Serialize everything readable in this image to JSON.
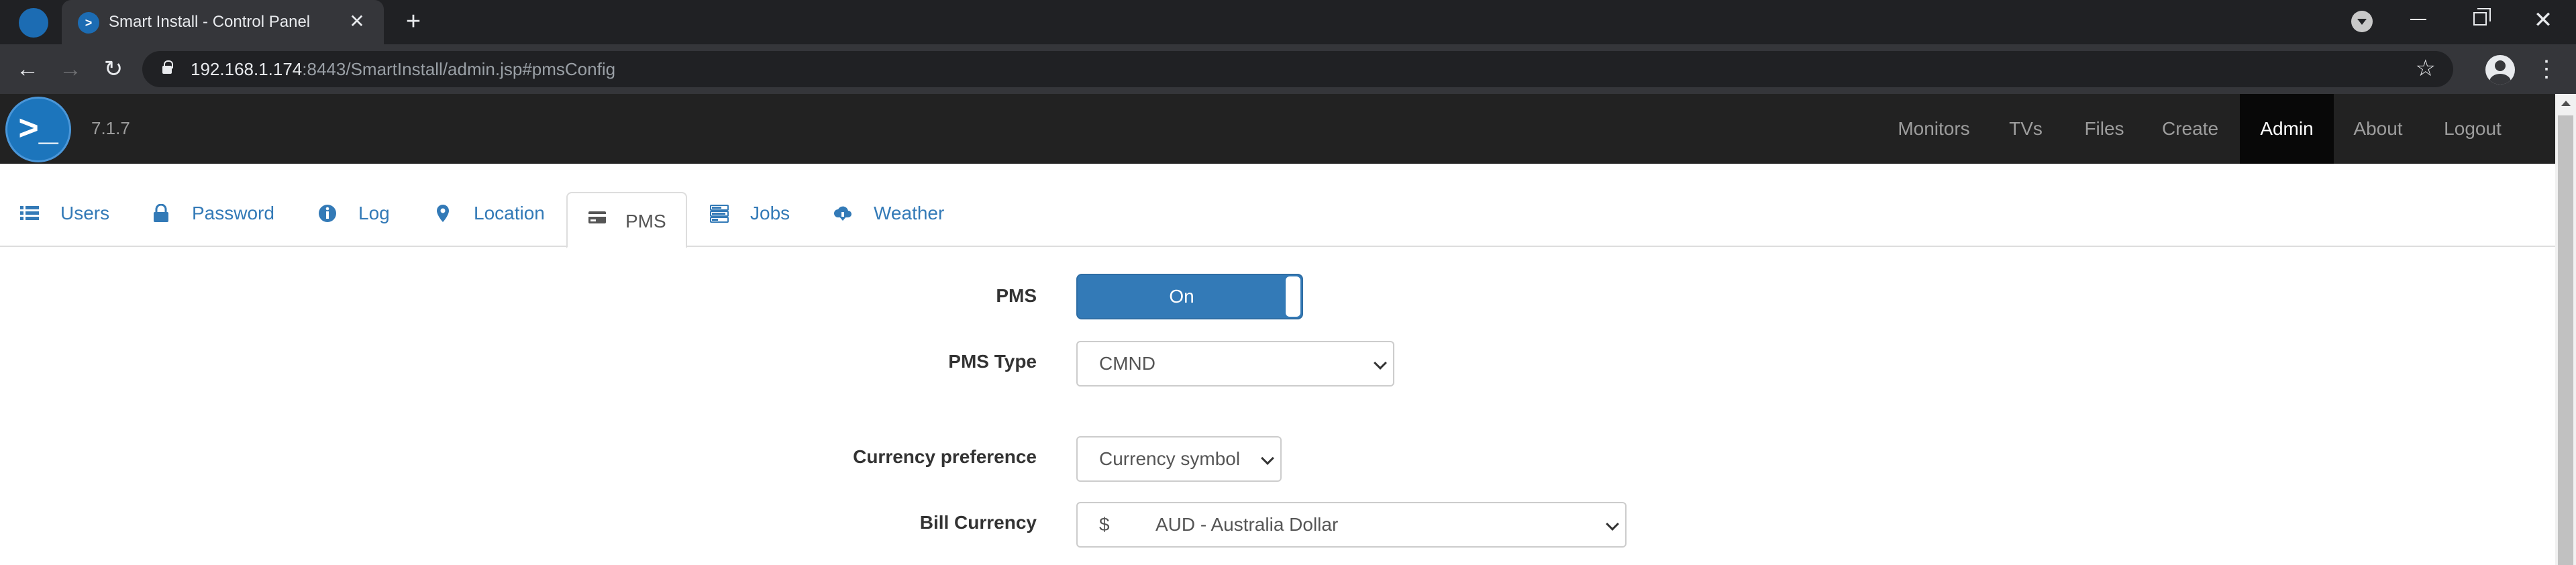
{
  "browser": {
    "tab_title": "Smart Install - Control Panel",
    "tab_close": "✕",
    "new_tab": "+",
    "url_host": "192.168.1.174",
    "url_rest": ":8443/SmartInstall/admin.jsp#pmsConfig",
    "back": "←",
    "forward": "→",
    "reload": "↻",
    "star": "☆",
    "menu": "⋮",
    "close_window": "✕",
    "favicon_glyph": ">"
  },
  "app": {
    "logo_glyph": ">_",
    "version": "7.1.7",
    "brand_color": "#1c75bc",
    "nav": [
      {
        "label": "Monitors",
        "active": false
      },
      {
        "label": "TVs",
        "active": false
      },
      {
        "label": "Files",
        "active": false
      },
      {
        "label": "Create",
        "active": false
      },
      {
        "label": "Admin",
        "active": true
      },
      {
        "label": "About",
        "active": false
      },
      {
        "label": "Logout",
        "active": false
      }
    ]
  },
  "tabs": [
    {
      "label": "Users",
      "icon": "list-icon",
      "active": false
    },
    {
      "label": "Password",
      "icon": "lock-icon",
      "active": false
    },
    {
      "label": "Log",
      "icon": "info-icon",
      "active": false
    },
    {
      "label": "Location",
      "icon": "map-marker-icon",
      "active": false
    },
    {
      "label": "PMS",
      "icon": "credit-card-icon",
      "active": true
    },
    {
      "label": "Jobs",
      "icon": "tasks-icon",
      "active": false
    },
    {
      "label": "Weather",
      "icon": "cloud-download-icon",
      "active": false
    }
  ],
  "form": {
    "pms_label": "PMS",
    "pms_toggle": "On",
    "pms_type_label": "PMS Type",
    "pms_type_value": "CMND",
    "currency_pref_label": "Currency preference",
    "currency_pref_value": "Currency symbol",
    "bill_currency_label": "Bill Currency",
    "bill_currency_symbol": "$",
    "bill_currency_value": "AUD - Australia Dollar"
  }
}
